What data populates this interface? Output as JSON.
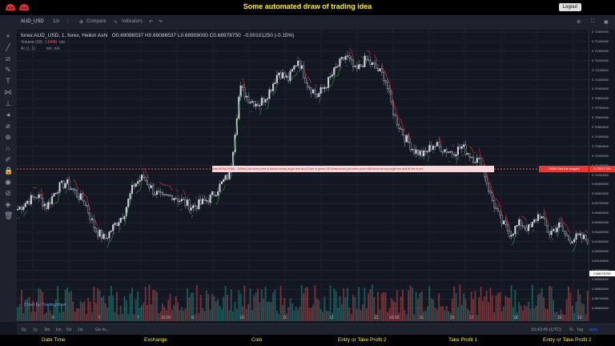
{
  "header": {
    "title": "Some automated draw of trading idea",
    "logout": "Logout"
  },
  "toolbar": {
    "symbol": "AUD_USD",
    "interval": "1m",
    "compare": "Compare",
    "indicators": "Indicators"
  },
  "legend": {
    "main": "forex:AUD_USD, 1, forex, Heikin Ashi",
    "open": "O0.69086537",
    "high": "H0.69086537",
    "low": "L0.68908000",
    "close": "C0.68978750",
    "change": "-0.00101250 (-0.15%)",
    "volume": "Volume (20)",
    "volume_value": "1.8440",
    "volume_na": "n/a",
    "ai": "AI (1, 1)",
    "ai_na1": "n/a",
    "ai_na2": "n/a"
  },
  "price_axis": [
    "0.71500000",
    "0.71400000",
    "0.71300000",
    "0.71200000",
    "0.71100000",
    "0.71000000",
    "0.70900000",
    "0.70800000",
    "0.70700000",
    "0.70600000",
    "0.70500000",
    "0.70400000",
    "0.70300000",
    "0.70200000",
    "0.70100000",
    "0.70000000",
    "0.69900000",
    "0.69800000",
    "0.69700000",
    "0.69600000",
    "0.69500000",
    "0.69400000",
    "0.69300000",
    "0.69200000",
    "0.69100000",
    "0.69000000",
    "0.68900000",
    "0.68800000",
    "0.68700000",
    "0.68600000"
  ],
  "time_axis": [
    "4",
    "5",
    "7",
    "10:00",
    "9",
    "10",
    "11",
    "12",
    "13",
    "16:00",
    "15",
    "16",
    "17",
    "18",
    "19",
    "10"
  ],
  "signal": {
    "text": "Start till flip ENDD  -  DRAW just when   price is above strong angle line and AI line is green        OR         draw shorts just when price still below strong angle line and AI line is red",
    "then": "THEN See the magic!!",
    "current_price": "0.70071750",
    "last_price": "0.68978750"
  },
  "watermark": "Chart by TradingView",
  "bottom": {
    "ranges": [
      "5y",
      "1y",
      "3m",
      "1m",
      "5d",
      "1d"
    ],
    "goto": "Go to...",
    "time": "10:43:45 (UTC)",
    "percent": "%",
    "log": "log",
    "auto": "auto"
  },
  "footer": [
    "Date Time",
    "Exchange",
    "Coin",
    "Entry or Take Profit 2",
    "Take Profit 1",
    "Entry or Take Profit 2"
  ],
  "colors": {
    "up": "#26a69a",
    "down": "#ef5350",
    "bg": "#131722",
    "accent": "#ffeb3b"
  },
  "chart_data": {
    "type": "heikin-ashi candlestick",
    "symbol": "AUD_USD",
    "ylim": [
      0.6855,
      0.7152
    ],
    "close_path": [
      0.6935,
      0.6945,
      0.6952,
      0.6938,
      0.696,
      0.6968,
      0.6955,
      0.6942,
      0.691,
      0.6898,
      0.6915,
      0.693,
      0.6965,
      0.6975,
      0.6958,
      0.6948,
      0.6952,
      0.6945,
      0.6938,
      0.6942,
      0.695,
      0.6965,
      0.698,
      0.7085,
      0.707,
      0.7065,
      0.708,
      0.7105,
      0.7095,
      0.712,
      0.709,
      0.7075,
      0.709,
      0.711,
      0.7125,
      0.7105,
      0.712,
      0.711,
      0.7098,
      0.705,
      0.7025,
      0.7008,
      0.7002,
      0.7015,
      0.701,
      0.7005,
      0.7012,
      0.7,
      0.6992,
      0.695,
      0.692,
      0.6905,
      0.6918,
      0.691,
      0.693,
      0.6905,
      0.6915,
      0.6898,
      0.69,
      0.6898
    ]
  }
}
